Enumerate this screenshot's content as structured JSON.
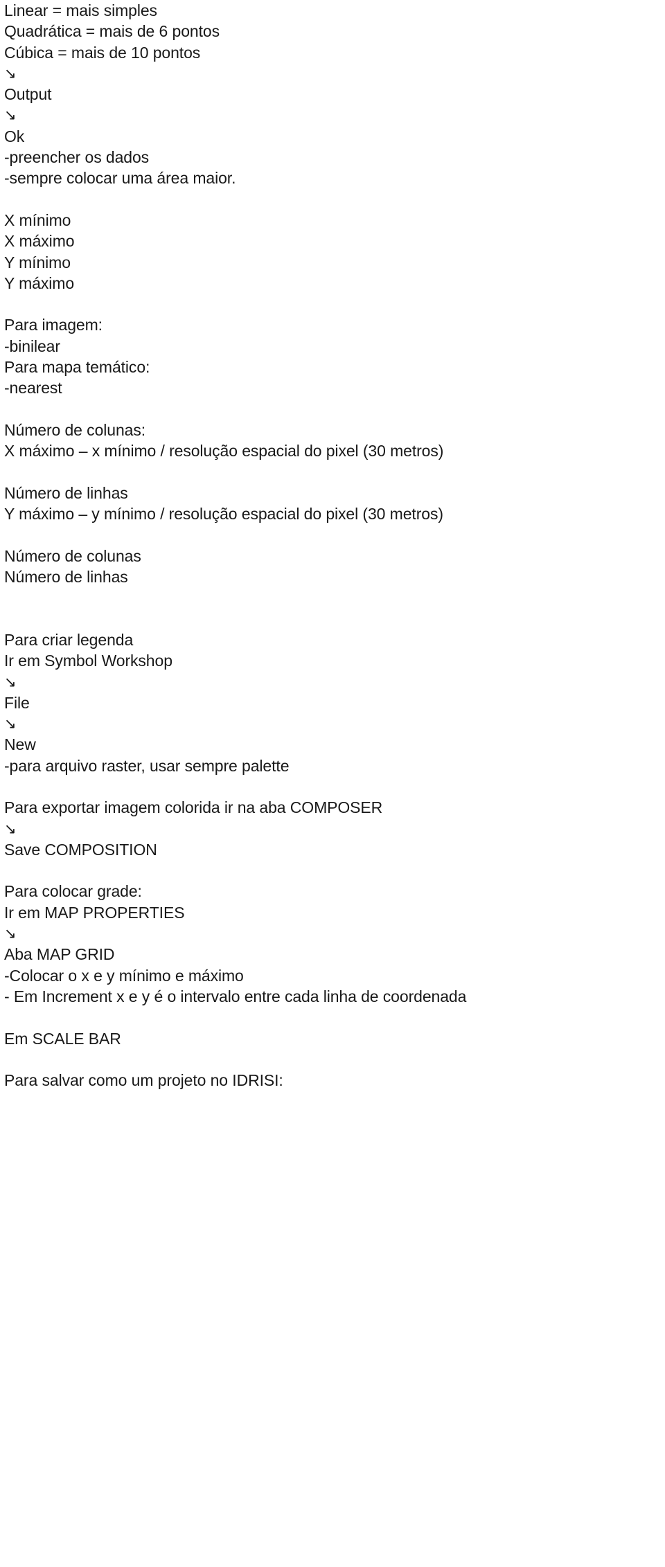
{
  "document": {
    "type": "plain-text-notes",
    "language": "pt-BR",
    "background_color": "#ffffff",
    "text_color": "#191919",
    "arrow_glyph": "↘",
    "arrow_icon_name": "arrow-down-right-icon",
    "lines": [
      {
        "id": "l1",
        "text": "Linear = mais simples",
        "kind": "text"
      },
      {
        "id": "l2",
        "text": "Quadrática = mais de 6 pontos",
        "kind": "text"
      },
      {
        "id": "l3",
        "text": "Cúbica = mais de 10 pontos",
        "kind": "text"
      },
      {
        "id": "l4",
        "text": "↘",
        "kind": "arrow"
      },
      {
        "id": "l5",
        "text": "Output",
        "kind": "text"
      },
      {
        "id": "l6",
        "text": "↘",
        "kind": "arrow"
      },
      {
        "id": "l7",
        "text": "Ok",
        "kind": "text"
      },
      {
        "id": "l8",
        "text": "-preencher os dados",
        "kind": "text"
      },
      {
        "id": "l9",
        "text": "-sempre colocar uma área maior.",
        "kind": "text"
      },
      {
        "id": "l10",
        "text": "",
        "kind": "blank"
      },
      {
        "id": "l11",
        "text": "X mínimo",
        "kind": "text"
      },
      {
        "id": "l12",
        "text": "X máximo",
        "kind": "text"
      },
      {
        "id": "l13",
        "text": "Y mínimo",
        "kind": "text"
      },
      {
        "id": "l14",
        "text": "Y máximo",
        "kind": "text"
      },
      {
        "id": "l15",
        "text": "",
        "kind": "blank"
      },
      {
        "id": "l16",
        "text": "Para imagem:",
        "kind": "text"
      },
      {
        "id": "l17",
        "text": "-binilear",
        "kind": "text"
      },
      {
        "id": "l18",
        "text": "Para mapa temático:",
        "kind": "text"
      },
      {
        "id": "l19",
        "text": "-nearest",
        "kind": "text"
      },
      {
        "id": "l20",
        "text": "",
        "kind": "blank"
      },
      {
        "id": "l21",
        "text": "Número de colunas:",
        "kind": "text"
      },
      {
        "id": "l22",
        "text": "X máximo – x mínimo / resolução espacial do pixel (30 metros)",
        "kind": "text"
      },
      {
        "id": "l23",
        "text": "",
        "kind": "blank"
      },
      {
        "id": "l24",
        "text": "Número de linhas",
        "kind": "text"
      },
      {
        "id": "l25",
        "text": "Y máximo – y mínimo / resolução espacial do pixel (30 metros)",
        "kind": "text"
      },
      {
        "id": "l26",
        "text": "",
        "kind": "blank"
      },
      {
        "id": "l27",
        "text": "Número de colunas",
        "kind": "text"
      },
      {
        "id": "l28",
        "text": "Número de linhas",
        "kind": "text"
      },
      {
        "id": "l29",
        "text": "",
        "kind": "blank"
      },
      {
        "id": "l30",
        "text": "",
        "kind": "blank"
      },
      {
        "id": "l31",
        "text": "Para criar legenda",
        "kind": "text"
      },
      {
        "id": "l32",
        "text": "Ir em Symbol Workshop",
        "kind": "text"
      },
      {
        "id": "l33",
        "text": "↘",
        "kind": "arrow"
      },
      {
        "id": "l34",
        "text": "File",
        "kind": "text"
      },
      {
        "id": "l35",
        "text": "↘",
        "kind": "arrow"
      },
      {
        "id": "l36",
        "text": "New",
        "kind": "text"
      },
      {
        "id": "l37",
        "text": "-para arquivo raster, usar sempre palette",
        "kind": "text"
      },
      {
        "id": "l38",
        "text": "",
        "kind": "blank"
      },
      {
        "id": "l39",
        "text": "Para exportar imagem colorida ir na aba COMPOSER",
        "kind": "text"
      },
      {
        "id": "l40",
        "text": "↘",
        "kind": "arrow"
      },
      {
        "id": "l41",
        "text": "Save COMPOSITION",
        "kind": "text"
      },
      {
        "id": "l42",
        "text": "",
        "kind": "blank"
      },
      {
        "id": "l43",
        "text": "Para colocar grade:",
        "kind": "text"
      },
      {
        "id": "l44",
        "text": "Ir em MAP PROPERTIES",
        "kind": "text"
      },
      {
        "id": "l45",
        "text": "↘",
        "kind": "arrow"
      },
      {
        "id": "l46",
        "text": "Aba MAP GRID",
        "kind": "text"
      },
      {
        "id": "l47",
        "text": "-Colocar o x e y mínimo e máximo",
        "kind": "text"
      },
      {
        "id": "l48",
        "text": "- Em Increment x e y é o intervalo entre cada linha de coordenada",
        "kind": "text"
      },
      {
        "id": "l49",
        "text": "",
        "kind": "blank"
      },
      {
        "id": "l50",
        "text": "Em SCALE BAR",
        "kind": "text"
      },
      {
        "id": "l51",
        "text": "",
        "kind": "blank"
      },
      {
        "id": "l52",
        "text": "Para salvar como um projeto no IDRISI:",
        "kind": "text"
      }
    ]
  }
}
